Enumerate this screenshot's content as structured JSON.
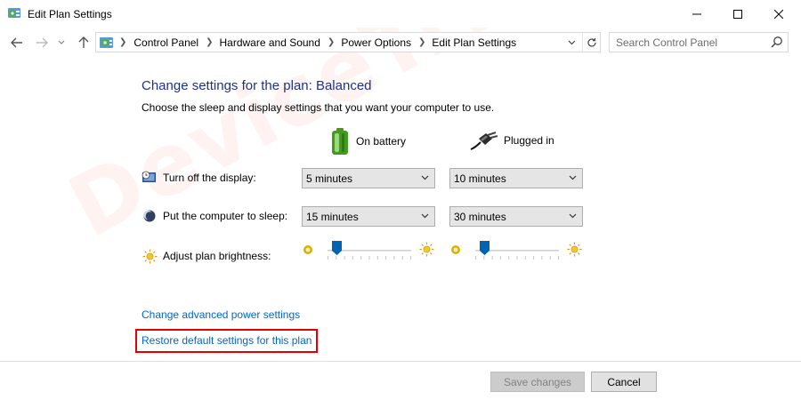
{
  "window": {
    "title": "Edit Plan Settings",
    "icon": "control-panel-icon",
    "minimize_icon": "minimize-icon",
    "maximize_icon": "maximize-icon",
    "close_icon": "close-icon"
  },
  "nav": {
    "back_icon": "arrow-left-icon",
    "forward_icon": "arrow-right-icon",
    "recent_icon": "chevron-down-icon",
    "up_icon": "arrow-up-icon",
    "breadcrumbs": [
      "Control Panel",
      "Hardware and Sound",
      "Power Options",
      "Edit Plan Settings"
    ],
    "search_placeholder": "Search Control Panel"
  },
  "main": {
    "heading": "Change settings for the plan: Balanced",
    "subheading": "Choose the sleep and display settings that you want your computer to use.",
    "columns": {
      "battery": "On battery",
      "plugged": "Plugged in"
    },
    "rows": {
      "display": {
        "label": "Turn off the display:",
        "battery": "5 minutes",
        "plugged": "10 minutes"
      },
      "sleep": {
        "label": "Put the computer to sleep:",
        "battery": "15 minutes",
        "plugged": "30 minutes"
      },
      "brightness": {
        "label": "Adjust plan brightness:",
        "battery_level": 0.07,
        "plugged_level": 0.07
      }
    },
    "links": {
      "advanced": "Change advanced power settings",
      "restore": "Restore default settings for this plan"
    }
  },
  "footer": {
    "save": "Save changes",
    "cancel": "Cancel"
  },
  "watermark": "DeviceTricks",
  "colors": {
    "heading": "#1e3287",
    "link": "#0066cc",
    "highlight": "#e30000",
    "slider_thumb": "#0063b1"
  }
}
